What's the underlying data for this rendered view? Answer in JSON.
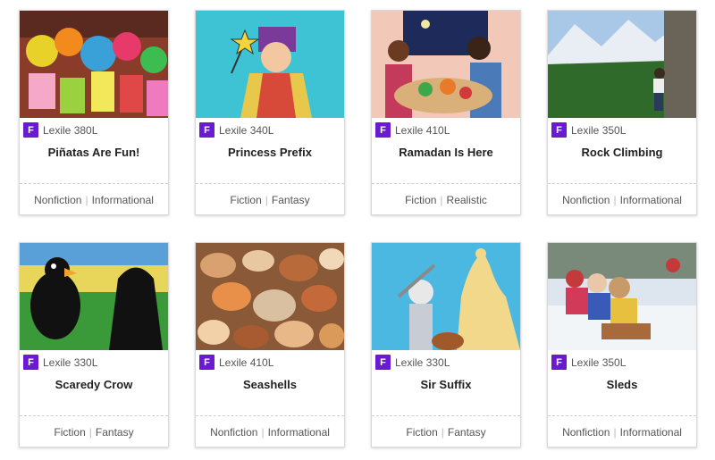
{
  "books": [
    {
      "title": "Piñatas Are Fun!",
      "level_badge": "F",
      "lexile": "Lexile 380L",
      "tag1": "Nonfiction",
      "tag2": "Informational",
      "separator": "|"
    },
    {
      "title": "Princess Prefix",
      "level_badge": "F",
      "lexile": "Lexile 340L",
      "tag1": "Fiction",
      "tag2": "Fantasy",
      "separator": "|"
    },
    {
      "title": "Ramadan Is Here",
      "level_badge": "F",
      "lexile": "Lexile 410L",
      "tag1": "Fiction",
      "tag2": "Realistic",
      "separator": "|"
    },
    {
      "title": "Rock Climbing",
      "level_badge": "F",
      "lexile": "Lexile 350L",
      "tag1": "Nonfiction",
      "tag2": "Informational",
      "separator": "|"
    },
    {
      "title": "Scaredy Crow",
      "level_badge": "F",
      "lexile": "Lexile 330L",
      "tag1": "Fiction",
      "tag2": "Fantasy",
      "separator": "|"
    },
    {
      "title": "Seashells",
      "level_badge": "F",
      "lexile": "Lexile 410L",
      "tag1": "Nonfiction",
      "tag2": "Informational",
      "separator": "|"
    },
    {
      "title": "Sir Suffix",
      "level_badge": "F",
      "lexile": "Lexile 330L",
      "tag1": "Fiction",
      "tag2": "Fantasy",
      "separator": "|"
    },
    {
      "title": "Sleds",
      "level_badge": "F",
      "lexile": "Lexile 350L",
      "tag1": "Nonfiction",
      "tag2": "Informational",
      "separator": "|"
    }
  ],
  "colors": {
    "level_badge": "#6a1bd1",
    "card_border": "#d9d9d9"
  }
}
